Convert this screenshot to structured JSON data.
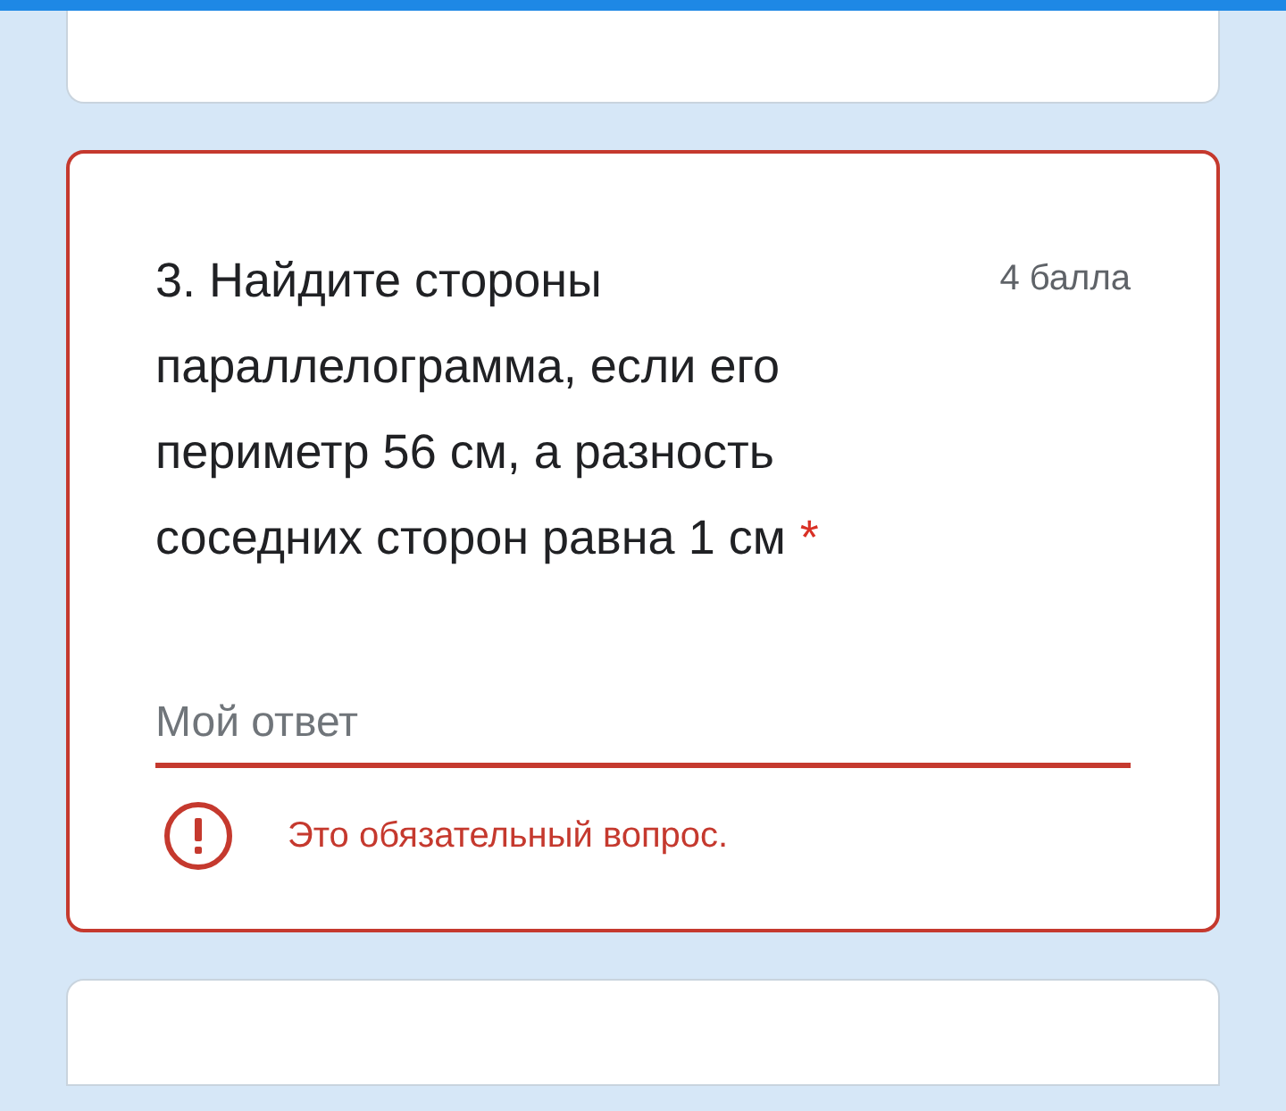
{
  "question": {
    "text": "3. Найдите стороны параллелограмма, если его периметр 56 см, а разность соседних сторон равна 1 см",
    "required_mark": "*",
    "points": "4 балла",
    "invalid": true,
    "answer": {
      "placeholder": "Мой ответ"
    },
    "error": "Это обязательный вопрос."
  }
}
